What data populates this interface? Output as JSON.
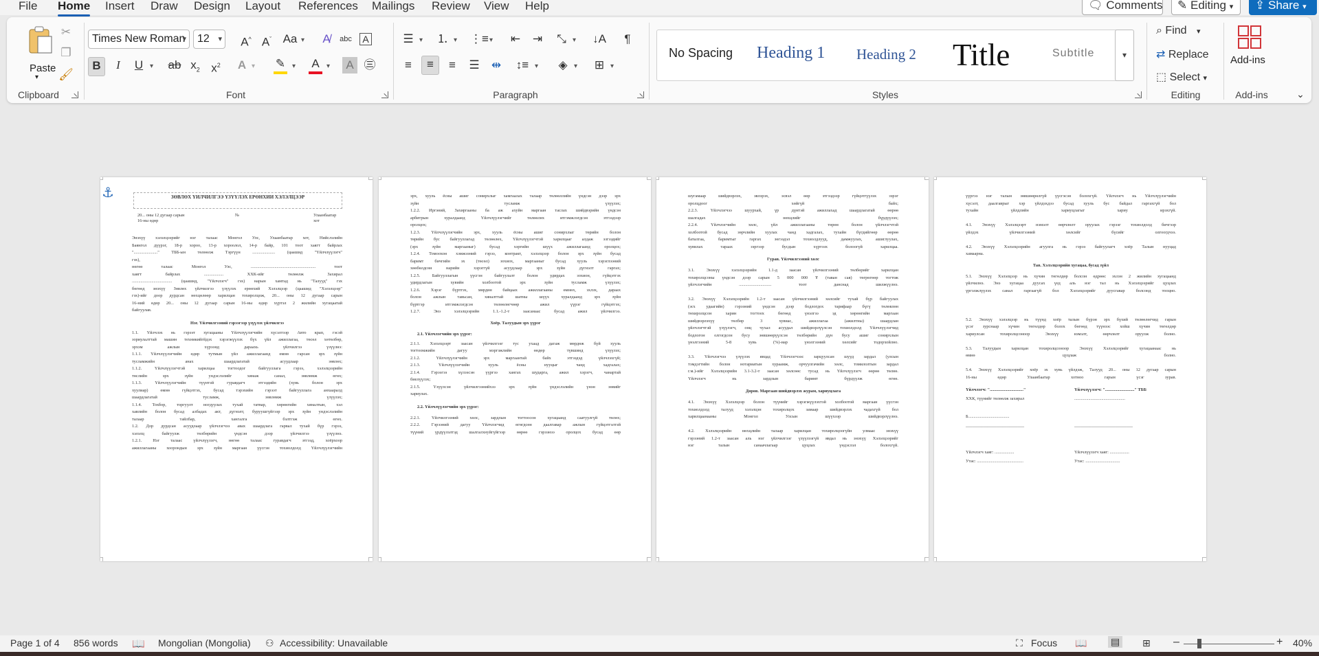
{
  "menu": {
    "tabs": [
      "File",
      "Home",
      "Insert",
      "Draw",
      "Design",
      "Layout",
      "References",
      "Mailings",
      "Review",
      "View",
      "Help"
    ],
    "comments": "Comments",
    "editing_mode": "Editing",
    "share": "Share"
  },
  "ribbon": {
    "clipboard": {
      "label": "Clipboard",
      "paste": "Paste"
    },
    "font": {
      "label": "Font",
      "family": "Times New Roman",
      "size": "12",
      "change_case": "Aa",
      "font_color": "#e81123",
      "highlight_color": "#ffd700"
    },
    "paragraph": {
      "label": "Paragraph",
      "pilcrow": "¶"
    },
    "styles": {
      "label": "Styles",
      "items": [
        "No Spacing",
        "Heading 1",
        "Heading 2",
        "Title",
        "Subtitle"
      ],
      "heading_color": "#2f5496"
    },
    "editing": {
      "label": "Editing",
      "find": "Find",
      "replace": "Replace",
      "select": "Select"
    },
    "addins": {
      "label": "Add-ins",
      "button": "Add-ins",
      "icon_color": "#d13438"
    }
  },
  "document": {
    "page1": {
      "title": "ЗӨВЛӨХ ҮЙЛЧИЛГЭЭ ҮЗҮҮЛЭХ ЕРӨНХИЙ ХЭЛЭЛЦЭЭР",
      "date_line": "20... оны 12 дугаар сарын 16-ны өдөр",
      "no": "№",
      "city": "Улаанбаатар хот",
      "intro": [
        "Энэхүү хэлэлцээрийг нэг талаас Монгол Улс, Улаанбаатар хот, Нийслэлийн",
        "Баянгол дүүрэг, 18-р хороо, 13-р хороолол, 14-р байр, 101 тоот хаягт байрлах",
        "\"......................\" ТББ-ын төлөөлж Тэргүүн ..................... (цаашид \"Үйлчлүүлэгч\"",
        "гэх),",
        "нөгөө талаас Монгол Улс, ............................................................ тоот",
        "хаягт байрлах .................. ХХК-ийг төлөөлж Захирал",
        "..................................... (цаашид, \"Үйлчлэгч\" гэх) нарын хамтад нь \"Талууд\" гэх",
        "бөгөөд энэхүү Зөвлөх үйлчилгээ үзүүлэх ерөнхий Хэлэлцээр (цаашид \"Хэлэлцээр\"",
        "гэх)-ийг доор дурдсан нөхцөлөөр харилцан тохиролцож, 20... оны 12 дугаар сарын",
        "16-ний өдөр 20... оны 12 дугаар сарын 16-ны өдөр хүртэл 2 жилийн хугацаатай",
        "байгуулав."
      ],
      "section1": "Нэг. Үйлчилгээний гэрээгээр үзүүлэх үйлчилгээ",
      "body": [
        "1.1. Үйлчлэх нь гэрээт хугацааны Үйлчлүүлэгчийн хүсэлтээр Авто крап, гэсэй",
        "зориулалттай машин техникийгйдэх хэрэгжүүлэх бүх үйл ажиллагаа, төсөл хөтөлбөр,",
        "эрхэм ажлын хүрээнд дараахь үйлчилгээ үзүүлнэ:",
        "1.1.1. Үйлчлүүлэгчийн өдөр тутмын үйл ажиллагаанд өмнө гарсан эрх зүйн",
        "тусламжийн анах шаардлагатай асуудлаар зөвлөх;",
        "1.1.2. Үйлчлүүлэгчтэй харилцаа тогтоодог байгууллага гэрээ, хэлэлцээрийн",
        "төслийн эрх зүйн ундэслэлийг хянаж санал, зөвлөмж өгөх;",
        "1.1.3. Үйлчлүүлэгчийн түүнтэй гуравдагч этгээдийн (хувь болон эрх",
        "хуулиар) өмнө гүйцэтгэх, бусад тэрэхийн гэрээт байгууллага анхааралд",
        "шаардлагатай тусламж, зөвлөмж үзүүлэх;",
        "1.1.4. Тохбор, торгуулт ногдуулах тухай татвар, хөрөнгийн хяналтын, хэл",
        "хавлийн болон бусад албадах акт, дүгнэлт, буруушгүйгээр эрх зүйн ундэслэлийн",
        "талаар тайлбар, хангалга бэлтгэж өгөх.",
        "1.2. Дор дурдсан асуудлаар үйлчлэгчээ авах шаардлага гарвал тухай бүр гэрээ,",
        "хэлэлц байгуулж төлбөрийн үндсэн дээр үйлчилгээ үзүүлнэ.",
        "1.2.1. Нэг талаас үйлчлүүлэгч, нөгөө талаас гуравдагч этгээд, хоёрхоор",
        "ажиллагааны хоорондын эрх зүйн маргаан үүсгэн тохиолдолд Үйлчлүүлэгчийн"
      ]
    },
    "page2": {
      "lines_a": [
        "эрх, хууль ёсны ашиг сонирхлыг хамгаалах талаар төлөөллийн үндсэн дээр эрх",
        "зүйн тусламж үзүүлэх;",
        "1.2.2. Иргэний, Захиргааны ба аж ахуйн маргаан таслах шийдвэрийн үндсэн",
        "арбитрын хуралдаанд Үйлчлүүлэгчийг төлөөлөх итгэмжлэгдсэн этгээдээр",
        "оролцох;",
        "1.2.3. Үйлчлүүлэгчийн эрх, хууль ёсны ашиг сонирхлыг төрийн болон",
        "төрийн бус байгууллагад төлөөлөх, Үйлчлүүлэгчтэй харилцааг алдаж эзгээдийг",
        "(эрх зүйн маргааныг) бусад хэргийн шүүх ажиллагаанд оролцох;",
        "1.2.4. Томоохон хэмжээний гэрээ, контракт, хэлэлцээр болон эрх зүйн бусад",
        "баримт бичгийн эх (төсөл) зохиох, маргааныг бусад хууль хэрэглээний",
        "хөөбөлдсөн нарийн хэрэггүй асуудлаар эрх зүйн дүгнэлт гаргах;",
        "1.2.5. Байгууллагын үүсгэн байгуулалт болон удирдах зохион, гүйцэтгэх",
        "удирдлагын хувийн холбоотой эрх зүйн тусламж үзүүлэх;",
        "1.2.6. Хэрэг бүртгэх, мөрдөн байцаах ажиллагааны өмнөх, эхлэх, дараах",
        "болон ажлын тавьсан, хяналттай шатны шүүх хуралдаанд эрх зүйн",
        "бүртгэр итгэмжлэгдсэн төлөөлөгчөөр ажил үүрэг гүйцэтгэх;",
        "1.2.7. Энэ хэлэлцээрийн 1.1.-1.2-т заасанаас бусад ажил үйлчилгээ."
      ],
      "section2": "Хоёр. Талуудын эрх үүрэг",
      "sub21": "2.1. Үйлчлэгчийн эрх үүрэг:",
      "lines_b": [
        "2.1.1. Хэлэлцээрт заасан үйлчилгээг тус ухаад дагаж мөрдөж бүй хууль",
        "тогтоомжийн дагуу мэргэжлийн өндөр түвшинд үзүүлэх;",
        "2.1.2. Үйлчлүүлэгчийн эрх маргаантай байх этгээдэд үйлчлэхгүй;",
        "2.1.3. Үйлчлүүлэгчийн хууль ёсны нууцыг чанд хадгалах;",
        "2.1.4. Гэрээгээ хүлээсэн үүргээ хангах шударга, ажил хэрэгч, чанартай",
        "биелүүлэх;",
        "2.1.5. Үзүүлсэн үйлчилгээнийхээ эрх зүйн үндэслэлийн үнэн зөвийг",
        "хариулах."
      ],
      "sub22": "2.2. Үйлчлүүлэгчийн эрх үүрэг:",
      "lines_c": [
        "2.2.1. Үйлчилгээний хөлс, зардлын тогтоосон хугацаанд саатуулгүй төлөх;",
        "2.2.2. Гэрээний дагуу Үйлчлэгчид өгөгдсөн даалгавар ажлын гүйцэтгэлтэй",
        "түүний үрдүүлэлтэд шалгалхнуйгүйгээр өөрөө гэрээнээ оролцох бусад өөр"
      ]
    },
    "page3": {
      "lines_a": [
        "шугамаар шийдвэрлэх, эвлэрэх, эсвэл өөр этгээдээр гүйцэтгүүлэх зэрэг",
        "оролцдоог хөйгүй байх;",
        "2.2.3. Үйлчлэгчээ шуурхай, үр дүнтэй ажиллахад шаардлагатай өөрөө",
        "шалгадах нөхцлийг бүрдүүлэх;",
        "2.2.4. Үйлчлэгчийн хөлс, үйл ажиллагааны төрөн болон үйлчлэгчтэй",
        "холбоотой бусад зөрчлийн хуулах чанд хадгалах, тухайн бүгдийгөөр өөрөө",
        "баталгаа, баримтыг гаргах зөгээдэл тохиолдлууд, дамжуулах, ашиглуулах,",
        "хувилах тараах зэргээр бусдын хүртээх болоогүй харилцаа."
      ],
      "section3": "Гурав. Үйлчилгээний хөлс",
      "lines_b": [
        "3.1. Энэхүү хэлэлцээрийн 1.1-д заасан үйлчилгээний төлбөрийг харилцан",
        "тохиролцсоны үндсэн дээр сарын 5 000 000 ₮ (таван сая) төгрөгөөр тогтож",
        "үйлчлэгчийн .............................. тоот данснад шилжүүлнэ.",
        "",
        "3.2. Энэхүү Хэлэлцээрийн 1.2-т заасан үйлчилгээний хөлсийг тухай бүр байгуулах",
        "(эсх удаагийн) гэрээний үндсэн дээр бодлогдох тарифаар бүгү төлөвлөн",
        "төхиролцсон харин тогтоох бөгөөд үнэлгээ эд хөрөнгийн маргаан",
        "шийдвэрлэхүү төлбөр 3 хувиас, ажиллагаа (ажилтны) шаардлан",
        "үйлчлэгчтэй үзүүлэгч, онц чухал асуудал шийдвэрлүүлсэн тохиолдолд Үйлчлүүлэгчид",
        "бодлогон олгогдсон бусу зөвшөөрүүлсэн төлбөрийн дүн бусу ашиг сонирхлын",
        "үнэлгээний 5-8 хувь (%)-иар үнэлгээний хөлсийг тодорхойлно.",
        "",
        "3.3. Үйлчлэгчээ үзүүлэх явцад Үйлчлэгчээс зарцуулсан шууд зардал (улсын",
        "тэмдэгтийн болон нотариатын хураамж, орчуулгачийн хөлс, томилолтын зардал",
        "г.м.)-ийг Хэлэлцээрийн 3.1-3.2-т заасан хөлсөөс тусад нь Үйлчлүүлэгч өөрөө төлнө.",
        "Үйлчлэгч нь зардлын баримт бүрдүүлж өгнө."
      ],
      "section4": "Дөрөв. Маргаан шийдвэрлэх журам, хариуцлага",
      "lines_c": [
        "4.1. Энэхүү Хэлэлцээр болон түүнийг хэрэгжүүлэхтэй холбоотой маргаан үүсгэн",
        "тохиолдолд талууд хэлэлцэн тохиролцох замаар шийдвэрлэх чадахгүй бол",
        "харилцаанааны Монгол Улсын шүүхээр шийдвэрлүүлнэ.",
        "",
        "4.2. Хэлэлцээрийн нөхцлийн талаар харилцан тохиролцоогүйн улмаас энэхүү",
        "гэрээний 1.2-т заасан аль нэг үйлчилгээг үзүүлээгүй явдал нь энэхүү Хэлэлцээрийг",
        "нэг талын санаачлагаар цуцлах үндэслэл болохгүй."
      ]
    },
    "page4": {
      "lines_a": [
        "үүргээ нэг талын зөвшөөрөлгүй үүсгэсэн болохгүй. Үйлчлэгч нь Үйлчлүүлэгчийн",
        "хүсэлт, даалгаврыг хэр үйлдэхдээ бусад хууль бус байдал гаргахгүй бол",
        "тухайн үйлдлийн хариуцлагыг хариу ирэхгүй.",
        "",
        "4.1. Энэхүү Хэлэлцээрт нэмэлт өөрчлөлт оруулах гэрээг тохиолдолд бичгээр",
        "үйлдэх үйлчилгээний хөлсийг бүсийг олгоогдчээ.",
        "",
        "4.2. Энэхүү Хэлэлцээрийн агуулга нь гэрээ байгуулагч хоёр Талын нууцад",
        "хамаарна."
      ],
      "section5": "Тав. Хэлэлцээрийн хугацаа, бусад зүйл",
      "lines_b": [
        "5.1. Энэхүү Хэлэлцээр нь хүчин төгөлдөр болсон өдрөөс эхлэн 2 жилийн хугацаанд",
        "үйлчилнэ. Энэ хугацаа дуусах үед аль нэг тал нь Хэлэлцээрийг цуцлах",
        "үргэлжлүүлэх санал гаргаагүй бол Хэлэлцээрийг дуусгавар болсонд тооцно.",
        "",
        "",
        "",
        "5.2. Энэхүү хэлэлцээр нь түүнд хоёр талын бүрэн эрх бүхий төлөөлөгчид гарын",
        "үсэг зурснаар хүчин төгөлдөр болох бөгөөд түүнээс хойш хүчин төгөлдөр",
        "хариулсан тохиролцсоноор Энэхүү нэмэлт, өөрчлөлт оруулж болно.",
        "",
        "5.3. Талуудын харилцан тохиролцсоноор Энэхүү Хэлэлцээрийг хугацаанаас нь",
        "өмнө цуцлаж болно.",
        "",
        "5.4. Энэхүү Хэлэлцээрийг хоёр эх хувь үйлдэж, Талууд 20... оны 12 дугаар сарын",
        "16-ны өдөр Улаанбаатар хотноо гарын үсэг зурав."
      ],
      "sign_left": [
        "Үйлчлэгч:  \"...............................\"",
        "ХХК, түүнийг төлөөлж захирал",
        "",
        "Б......................................",
        "___________________________",
        "",
        "",
        "Үйлчлэгч хаяг: ..................",
        "Утас: ..........................................."
      ],
      "sign_right": [
        "Үйлчлүүлэгч: \"...........................\" ТББ",
        "...............................................",
        "",
        "",
        "___________________________",
        "",
        "",
        "Үйлчлүүлэгч хаяг: ..................",
        "Утас: ................................"
      ]
    }
  },
  "status": {
    "page": "Page 1 of 4",
    "words": "856 words",
    "language": "Mongolian (Mongolia)",
    "accessibility": "Accessibility: Unavailable",
    "focus": "Focus",
    "zoom": "40%"
  }
}
